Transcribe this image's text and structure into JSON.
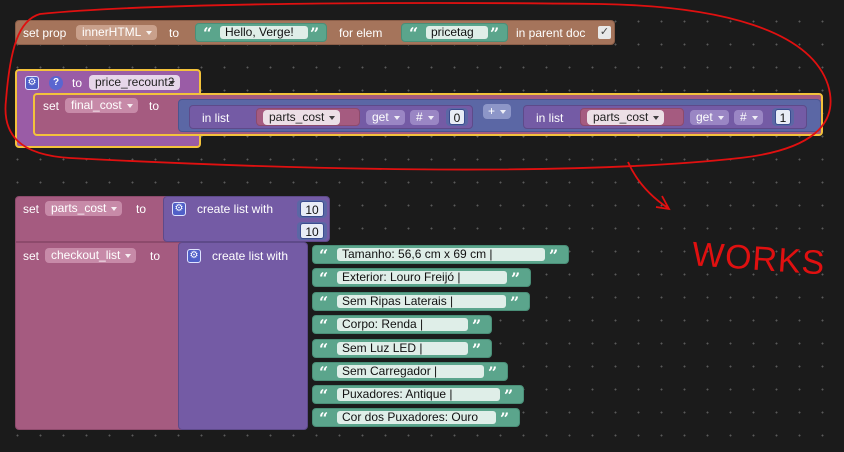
{
  "prop_block": {
    "set_prop": "set prop",
    "prop": "innerHTML",
    "to": "to",
    "value": "Hello, Verge!",
    "for_elem": "for elem",
    "elem": "pricetag",
    "in_parent_doc": "in parent doc",
    "checked": true
  },
  "proc_block": {
    "to": "to",
    "name": "price_recount2",
    "set": "set",
    "var": "final_cost",
    "to2": "to",
    "in_list": "in list",
    "list_a": "parts_cost",
    "get_a": "get",
    "hash_a": "#",
    "index_a": "0",
    "op": "+",
    "list_b": "parts_cost",
    "get_b": "get",
    "hash_b": "#",
    "index_b": "1"
  },
  "parts_block": {
    "set": "set",
    "var": "parts_cost",
    "to": "to",
    "create_list_with": "create list with",
    "items": [
      "10",
      "10"
    ]
  },
  "checkout_block": {
    "set": "set",
    "var": "checkout_list",
    "to": "to",
    "create_list_with": "create list with",
    "items": [
      "Tamanho: 56,6 cm x 69 cm      |",
      "Exterior: Louro Freijó      |",
      "Sem Ripas Laterais      |",
      "Corpo: Renda      |",
      "Sem Luz LED      |",
      "Sem Carregador      |",
      "Puxadores: Antique      |",
      "Cor dos Puxadores: Ouro"
    ]
  },
  "annotation": {
    "text": "WORKS",
    "color": "#e01010"
  },
  "colors": {
    "text_block": "#a5745b",
    "procedure": "#9a5ca6",
    "variable": "#a55b80",
    "list": "#745ba5",
    "math": "#5b67a5",
    "string": "#5ba58c",
    "selected_outline": "#f3c23b"
  }
}
